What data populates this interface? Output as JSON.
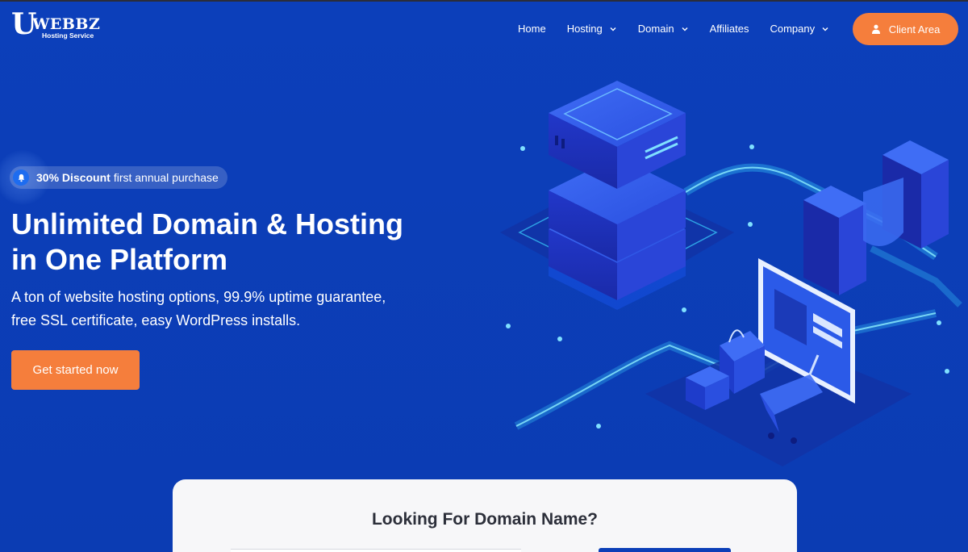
{
  "logo": {
    "letter": "U",
    "word": "WEBBZ",
    "tagline": "Hosting Service"
  },
  "nav": {
    "items": [
      {
        "label": "Home",
        "dropdown": false
      },
      {
        "label": "Hosting",
        "dropdown": true
      },
      {
        "label": "Domain",
        "dropdown": true
      },
      {
        "label": "Affiliates",
        "dropdown": false
      },
      {
        "label": "Company",
        "dropdown": true
      }
    ],
    "client_area": "Client Area"
  },
  "hero": {
    "badge": {
      "strong": "30% Discount",
      "rest": "first annual purchase",
      "icon": "bell-icon"
    },
    "title": "Unlimited Domain & Hosting in One Platform",
    "description": "A ton of website hosting options, 99.9% uptime guarantee, free SSL certificate, easy WordPress installs.",
    "cta": "Get started now"
  },
  "search": {
    "title": "Looking For Domain Name?"
  },
  "colors": {
    "background": "#0c3fba",
    "accent": "#f57e3c",
    "card": "#f7f7f9",
    "heading_dark": "#2c2f3a"
  }
}
